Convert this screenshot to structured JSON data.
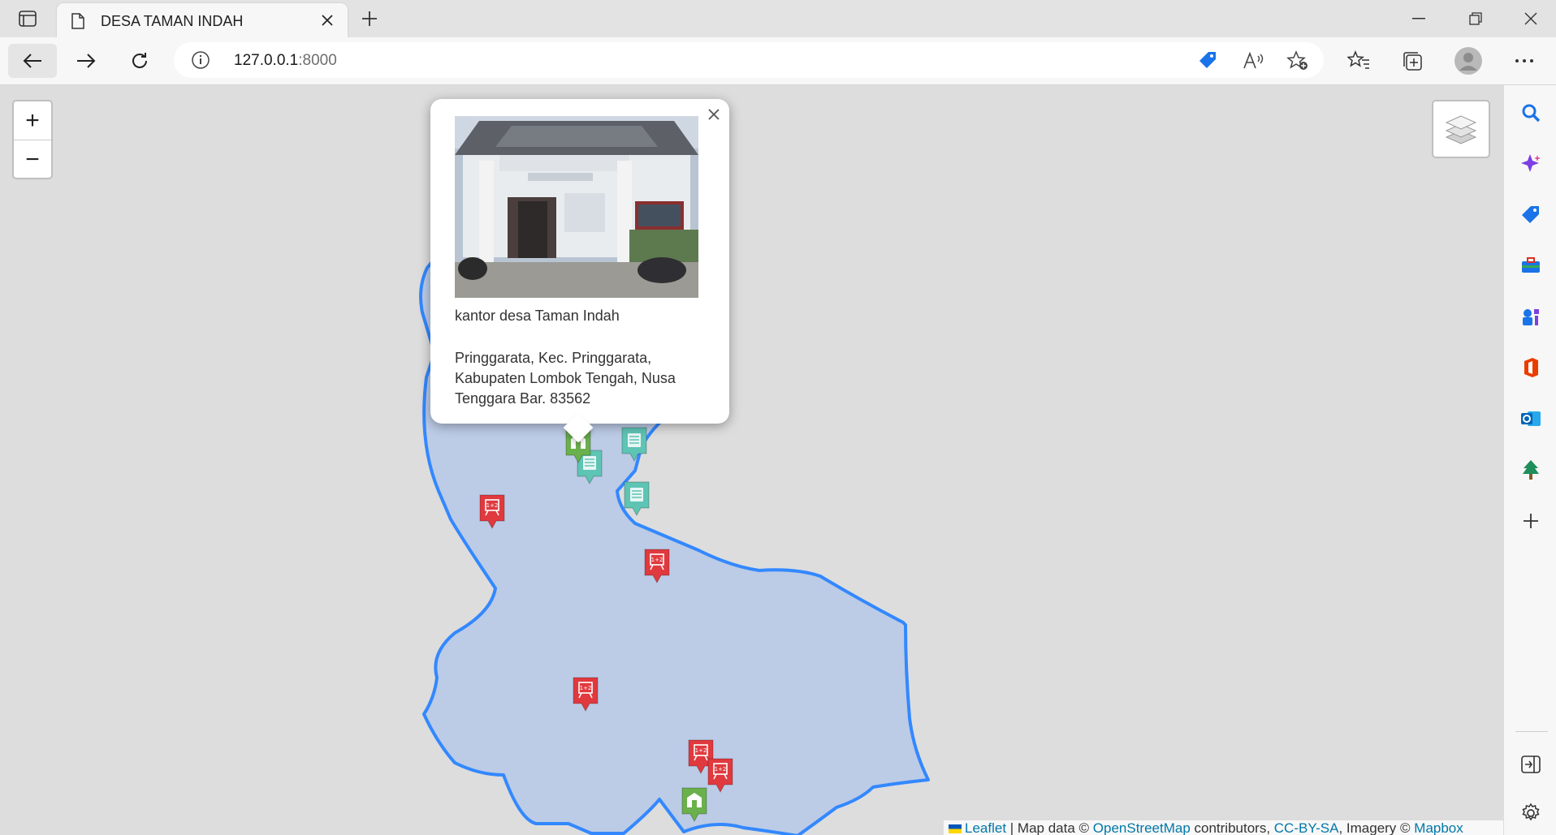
{
  "browser": {
    "tab_title": "DESA TAMAN INDAH",
    "url_host": "127.0.0.1",
    "url_port": ":8000",
    "icons": [
      "tab-actions-icon",
      "page-icon",
      "close-icon",
      "plus-icon",
      "minimize-icon",
      "restore-icon",
      "close-window-icon",
      "back-arrow-icon",
      "forward-arrow-icon",
      "refresh-icon",
      "info-icon",
      "tag-icon",
      "read-aloud-icon",
      "add-favorite-icon",
      "favorites-icon",
      "collections-icon",
      "profile-icon",
      "more-icon"
    ]
  },
  "map": {
    "zoom_in_label": "+",
    "zoom_out_label": "−",
    "boundary_color": "#3388ff",
    "boundary_fill": "#b9c9e6",
    "popup": {
      "name": "kantor desa Taman Indah",
      "address": "Pringgarata, Kec. Pringgarata, Kabupaten Lombok Tengah, Nusa Tenggara Bar. 83562"
    },
    "marker_types": {
      "school": "#e0393e",
      "office": "#5ec4b4",
      "health": "#6ab04c"
    },
    "attribution": {
      "leaflet": "Leaflet",
      "sep1": " | Map data © ",
      "osm": "OpenStreetMap",
      "sep2": " contributors, ",
      "license": "CC-BY-SA",
      "sep3": ", Imagery © ",
      "provider": "Mapbox"
    }
  },
  "sidebar": {
    "icons": [
      "search-icon",
      "copilot-icon",
      "shopping-icon",
      "tools-icon",
      "games-icon",
      "office-icon",
      "outlook-icon",
      "tree-icon",
      "add-icon",
      "hide-sidebar-icon",
      "settings-icon"
    ]
  }
}
